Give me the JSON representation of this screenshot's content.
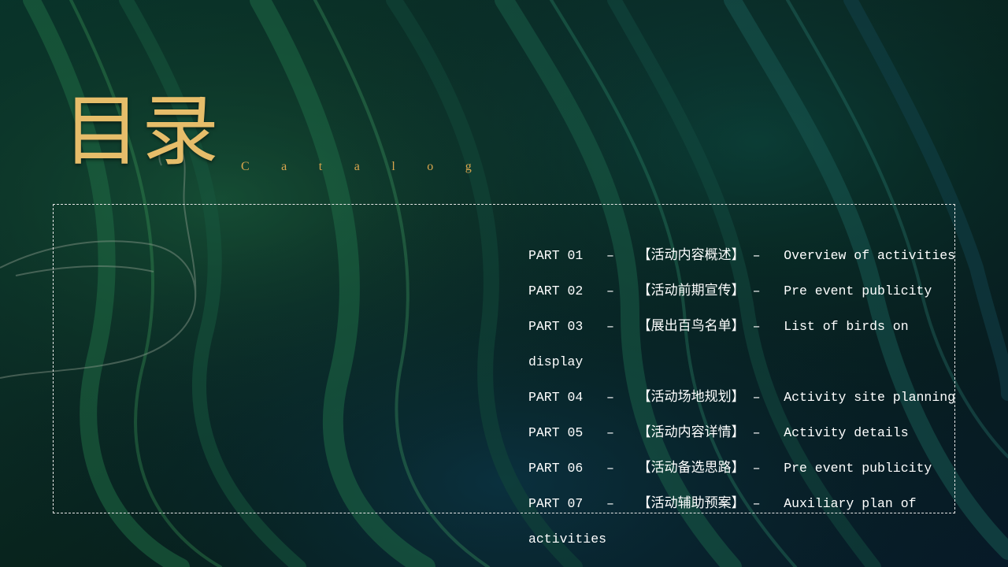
{
  "slide": {
    "title": "目录",
    "subtitle": "Catalog",
    "colors": {
      "title": "#e6bd6a",
      "subtitle": "#d9a64e",
      "text": "#ffffff",
      "frame": "#e6e6e6",
      "background": "#06201a"
    },
    "toc": [
      {
        "part": "PART 01",
        "sep1": "–",
        "cn": "【活动内容概述】",
        "sep2": "–",
        "en": "Overview of activities"
      },
      {
        "part": "PART 02",
        "sep1": "–",
        "cn": "【活动前期宣传】",
        "sep2": "–",
        "en": "Pre event publicity"
      },
      {
        "part": "PART 03",
        "sep1": "–",
        "cn": "【展出百鸟名单】",
        "sep2": "–",
        "en": "List of birds on display"
      },
      {
        "part": "PART 04",
        "sep1": "–",
        "cn": "【活动场地规划】",
        "sep2": "–",
        "en": "Activity site planning"
      },
      {
        "part": "PART 05",
        "sep1": "–",
        "cn": "【活动内容详情】",
        "sep2": "–",
        "en": "Activity details"
      },
      {
        "part": "PART 06",
        "sep1": "–",
        "cn": "【活动备选思路】",
        "sep2": "–",
        "en": "Pre event publicity"
      },
      {
        "part": "PART 07",
        "sep1": "–",
        "cn": "【活动辅助预案】",
        "sep2": "–",
        "en": "Auxiliary plan of activities"
      }
    ]
  }
}
